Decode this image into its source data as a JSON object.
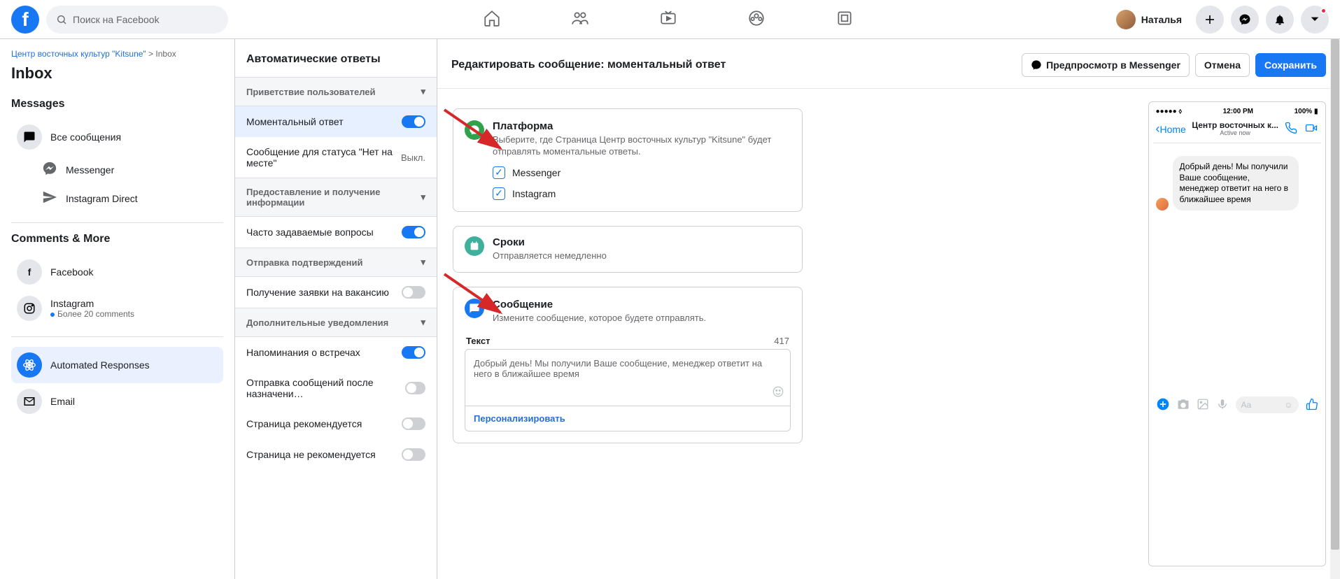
{
  "search_placeholder": "Поиск на Facebook",
  "user_name": "Наталья",
  "crumb_page": "Центр восточных культур \"Kitsune\"",
  "crumb_sep": ">",
  "crumb_section": "Inbox",
  "h1": "Inbox",
  "sec_messages": "Messages",
  "side": {
    "all": "Все сообщения",
    "messenger": "Messenger",
    "ig": "Instagram Direct"
  },
  "sec_comments": "Comments & More",
  "side2": {
    "fb": "Facebook",
    "ig": "Instagram",
    "ig_sub": "Более 20 comments",
    "auto": "Automated Responses",
    "email": "Email"
  },
  "mid_h": "Автоматические ответы",
  "groups": {
    "g1": "Приветствие пользователей",
    "g2": "Предоставление и получение информации",
    "g3": "Отправка подтверждений",
    "g4": "Дополнительные уведомления"
  },
  "opts": {
    "instant": "Моментальный ответ",
    "away": "Сообщение для статуса \"Нет на месте\"",
    "away_state": "Выкл.",
    "faq": "Часто задаваемые вопросы",
    "job": "Получение заявки на вакансию",
    "remind": "Напоминания о встречах",
    "after": "Отправка сообщений после назначени…",
    "rec": "Страница рекомендуется",
    "notrec": "Страница не рекомендуется"
  },
  "main_title": "Редактировать сообщение: моментальный ответ",
  "btn_preview": "Предпросмотр в Messenger",
  "btn_cancel": "Отмена",
  "btn_save": "Сохранить",
  "card_platform": {
    "t": "Платформа",
    "d": "Выберите, где Страница Центр восточных культур \"Kitsune\" будет отправлять моментальные ответы.",
    "c1": "Messenger",
    "c2": "Instagram"
  },
  "card_timing": {
    "t": "Сроки",
    "d": "Отправляется немедленно"
  },
  "card_msg": {
    "t": "Сообщение",
    "d": "Измените сообщение, которое будете отправлять.",
    "lab": "Текст",
    "cnt": "417",
    "text": "Добрый день! Мы получили Ваше сообщение, менеджер ответит на него в ближайшее время",
    "pers": "Персонализировать"
  },
  "phone": {
    "time": "12:00 PM",
    "batt": "100%",
    "back": "Home",
    "title": "Центр восточных к...",
    "sub": "Active now",
    "bubble": "Добрый день! Мы получили Ваше сообщение, менеджер ответит на него в ближайшее время",
    "inp": "Aa"
  }
}
